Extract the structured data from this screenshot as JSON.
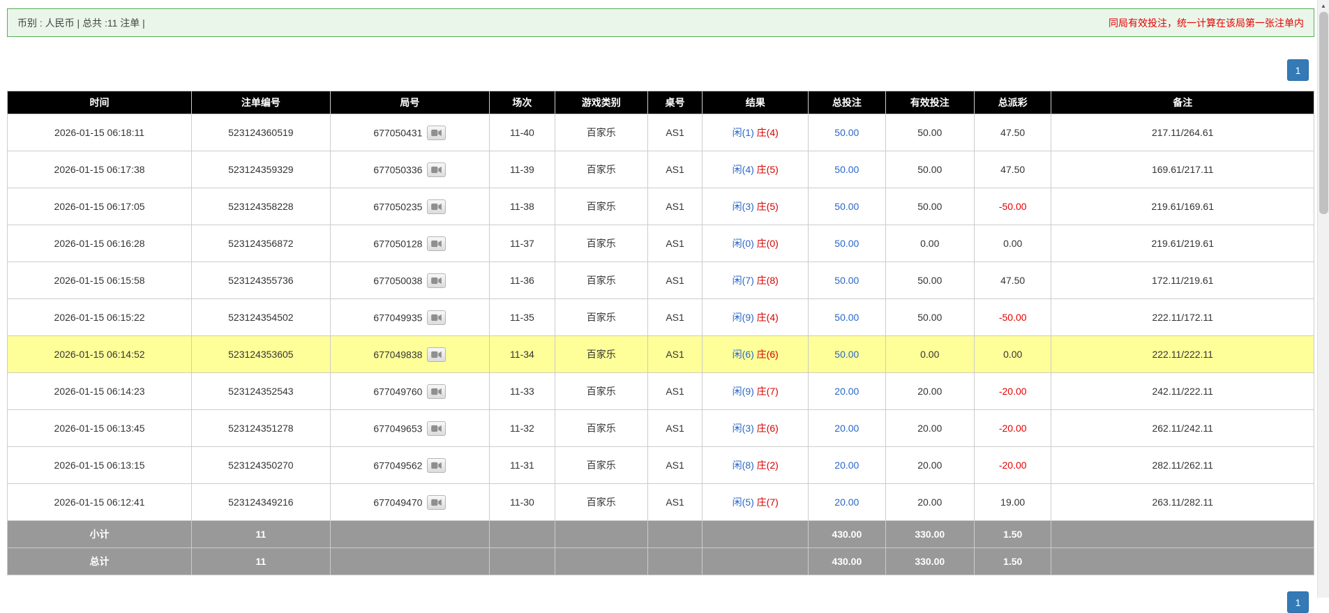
{
  "notice_bar": {
    "left": "币别 : 人民币 | 总共 :11 注单 |",
    "right": "同局有效投注，统一计算在该局第一张注单内"
  },
  "pagination": {
    "page": "1"
  },
  "icons": {
    "round_icon": "video-camera",
    "scroll_up_icon": "▲"
  },
  "colors": {
    "header_bg": "#000000",
    "highlight_row": "#ffff99",
    "footer_bg": "#999999",
    "link_blue": "#2a66c8",
    "player_blue": "#2a66c8",
    "banker_red": "#d40000",
    "negative_red": "#e60000",
    "notice_bg": "#eaf6ea",
    "notice_border": "#55ad55",
    "notice_text_red": "#e60000",
    "active_page_bg": "#337ab7"
  },
  "table": {
    "headers": [
      "时间",
      "注单编号",
      "局号",
      "场次",
      "游戏类别",
      "桌号",
      "结果",
      "总投注",
      "有效投注",
      "总派彩",
      "备注"
    ],
    "rows": [
      {
        "time": "2026-01-15 06:18:11",
        "bet_id": "523124360519",
        "round": "677050431",
        "session": "11-40",
        "game": "百家乐",
        "table_no": "AS1",
        "player": "闲(1)",
        "banker": "庄(4)",
        "total_bet": "50.00",
        "valid_bet": "50.00",
        "payout": "47.50",
        "remark": "217.11/264.61",
        "highlight": false
      },
      {
        "time": "2026-01-15 06:17:38",
        "bet_id": "523124359329",
        "round": "677050336",
        "session": "11-39",
        "game": "百家乐",
        "table_no": "AS1",
        "player": "闲(4)",
        "banker": "庄(5)",
        "total_bet": "50.00",
        "valid_bet": "50.00",
        "payout": "47.50",
        "remark": "169.61/217.11",
        "highlight": false
      },
      {
        "time": "2026-01-15 06:17:05",
        "bet_id": "523124358228",
        "round": "677050235",
        "session": "11-38",
        "game": "百家乐",
        "table_no": "AS1",
        "player": "闲(3)",
        "banker": "庄(5)",
        "total_bet": "50.00",
        "valid_bet": "50.00",
        "payout": "-50.00",
        "remark": "219.61/169.61",
        "highlight": false
      },
      {
        "time": "2026-01-15 06:16:28",
        "bet_id": "523124356872",
        "round": "677050128",
        "session": "11-37",
        "game": "百家乐",
        "table_no": "AS1",
        "player": "闲(0)",
        "banker": "庄(0)",
        "total_bet": "50.00",
        "valid_bet": "0.00",
        "payout": "0.00",
        "remark": "219.61/219.61",
        "highlight": false
      },
      {
        "time": "2026-01-15 06:15:58",
        "bet_id": "523124355736",
        "round": "677050038",
        "session": "11-36",
        "game": "百家乐",
        "table_no": "AS1",
        "player": "闲(7)",
        "banker": "庄(8)",
        "total_bet": "50.00",
        "valid_bet": "50.00",
        "payout": "47.50",
        "remark": "172.11/219.61",
        "highlight": false
      },
      {
        "time": "2026-01-15 06:15:22",
        "bet_id": "523124354502",
        "round": "677049935",
        "session": "11-35",
        "game": "百家乐",
        "table_no": "AS1",
        "player": "闲(9)",
        "banker": "庄(4)",
        "total_bet": "50.00",
        "valid_bet": "50.00",
        "payout": "-50.00",
        "remark": "222.11/172.11",
        "highlight": false
      },
      {
        "time": "2026-01-15 06:14:52",
        "bet_id": "523124353605",
        "round": "677049838",
        "session": "11-34",
        "game": "百家乐",
        "table_no": "AS1",
        "player": "闲(6)",
        "banker": "庄(6)",
        "total_bet": "50.00",
        "valid_bet": "0.00",
        "payout": "0.00",
        "remark": "222.11/222.11",
        "highlight": true
      },
      {
        "time": "2026-01-15 06:14:23",
        "bet_id": "523124352543",
        "round": "677049760",
        "session": "11-33",
        "game": "百家乐",
        "table_no": "AS1",
        "player": "闲(9)",
        "banker": "庄(7)",
        "total_bet": "20.00",
        "valid_bet": "20.00",
        "payout": "-20.00",
        "remark": "242.11/222.11",
        "highlight": false
      },
      {
        "time": "2026-01-15 06:13:45",
        "bet_id": "523124351278",
        "round": "677049653",
        "session": "11-32",
        "game": "百家乐",
        "table_no": "AS1",
        "player": "闲(3)",
        "banker": "庄(6)",
        "total_bet": "20.00",
        "valid_bet": "20.00",
        "payout": "-20.00",
        "remark": "262.11/242.11",
        "highlight": false
      },
      {
        "time": "2026-01-15 06:13:15",
        "bet_id": "523124350270",
        "round": "677049562",
        "session": "11-31",
        "game": "百家乐",
        "table_no": "AS1",
        "player": "闲(8)",
        "banker": "庄(2)",
        "total_bet": "20.00",
        "valid_bet": "20.00",
        "payout": "-20.00",
        "remark": "282.11/262.11",
        "highlight": false
      },
      {
        "time": "2026-01-15 06:12:41",
        "bet_id": "523124349216",
        "round": "677049470",
        "session": "11-30",
        "game": "百家乐",
        "table_no": "AS1",
        "player": "闲(5)",
        "banker": "庄(7)",
        "total_bet": "20.00",
        "valid_bet": "20.00",
        "payout": "19.00",
        "remark": "263.11/282.11",
        "highlight": false
      }
    ],
    "subtotal": {
      "label": "小计",
      "count": "11",
      "total_bet": "430.00",
      "valid_bet": "330.00",
      "payout": "1.50"
    },
    "total": {
      "label": "总计",
      "count": "11",
      "total_bet": "430.00",
      "valid_bet": "330.00",
      "payout": "1.50"
    }
  }
}
